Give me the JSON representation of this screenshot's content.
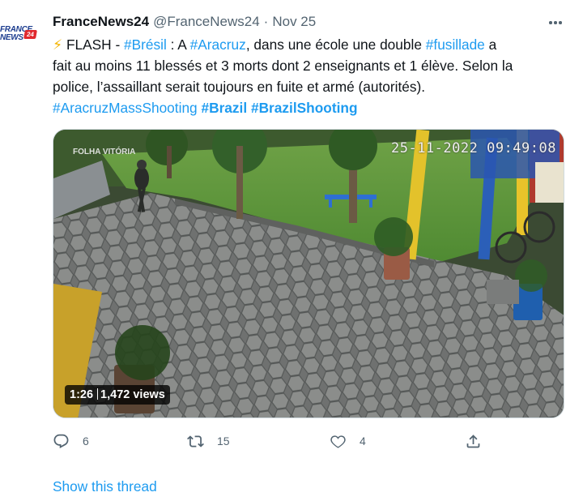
{
  "tweet": {
    "author": {
      "display_name": "FranceNews24",
      "handle": "@FranceNews24",
      "logo_lines": [
        "FRANCE",
        "NEWS"
      ],
      "logo_number": "24"
    },
    "separator": "·",
    "date": "Nov 25",
    "more_icon": "more-horizontal-icon",
    "text_runs": {
      "line1": [
        "⚡",
        " FLASH - ",
        "#Brésil",
        " : A ",
        "#Aracruz",
        ", dans une école une double ",
        "#fusillade",
        " a"
      ],
      "line2": "fait au moins 11 blessés et 3 morts dont 2 enseignants et 1 élève. Selon la",
      "line3": "police, l’assaillant serait toujours en fuite et armé (autorités).",
      "line4": [
        "#AracruzMassShooting",
        " ",
        "#Brazil",
        " ",
        "#BrazilShooting"
      ]
    },
    "media": {
      "timestamp_overlay": "25-11-2022 09:49:08",
      "watermark": "FOLHA VITÓRIA",
      "duration": "1:26",
      "views": "1,472 views"
    },
    "actions": {
      "reply_count": "6",
      "retweet_count": "15",
      "like_count": "4",
      "reply_icon": "reply-icon",
      "retweet_icon": "retweet-icon",
      "like_icon": "heart-icon",
      "share_icon": "share-icon"
    },
    "show_thread": "Show this thread",
    "colors": {
      "link": "#1d9bf0",
      "secondary_text": "#536471",
      "primary_text": "#0f1419"
    }
  }
}
